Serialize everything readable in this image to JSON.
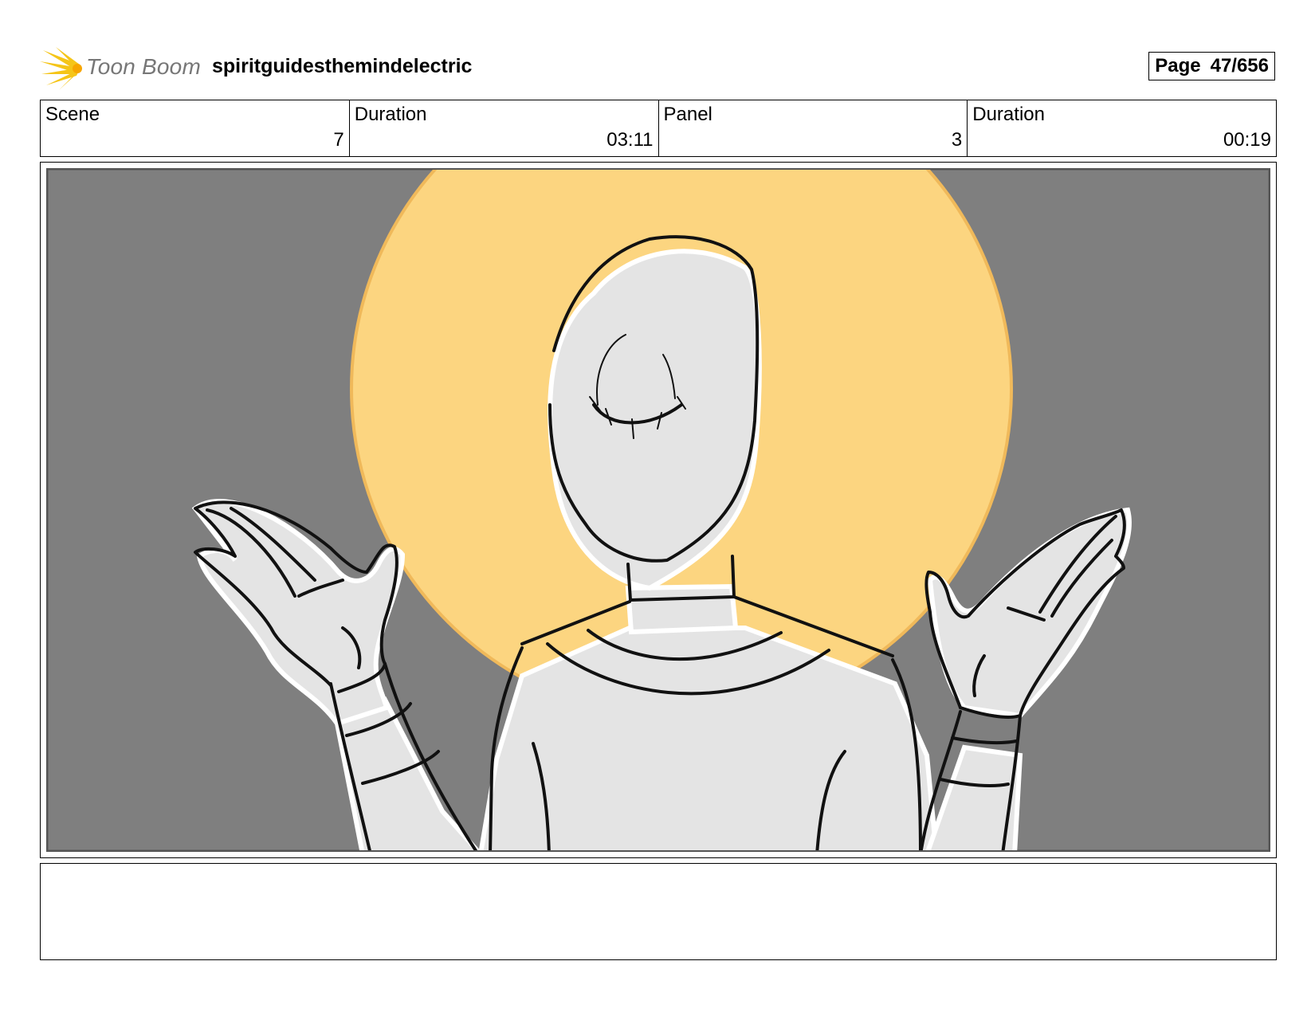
{
  "header": {
    "logo_text": "Toon Boom",
    "project_title": "spiritguidesthemindelectric",
    "page_label": "Page",
    "page_number": "47/656"
  },
  "info": {
    "scene_label": "Scene",
    "scene_value": "7",
    "scene_duration_label": "Duration",
    "scene_duration_value": "03:11",
    "panel_label": "Panel",
    "panel_value": "3",
    "panel_duration_label": "Duration",
    "panel_duration_value": "00:19"
  },
  "panel": {
    "background_color": "#7f7f7f",
    "halo_color": "#fcd580",
    "figure_fill": "#e4e4e4",
    "line_color": "#111111"
  },
  "notes": {
    "text": ""
  }
}
